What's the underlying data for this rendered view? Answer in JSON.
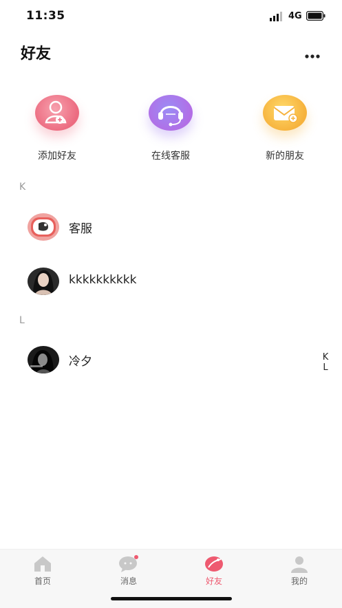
{
  "status_bar": {
    "time": "11:35",
    "network": "4G"
  },
  "header": {
    "title": "好友"
  },
  "actions": [
    {
      "label": "添加好友",
      "icon": "add-friend-icon",
      "color": "#ec6b80"
    },
    {
      "label": "在线客服",
      "icon": "headset-icon",
      "color": "#b26ee6"
    },
    {
      "label": "新的朋友",
      "icon": "envelope-icon",
      "color": "#f6b23c"
    }
  ],
  "sections": [
    {
      "letter": "K",
      "contacts": [
        {
          "name": "客服"
        },
        {
          "name": "kkkkkkkkkk"
        }
      ]
    },
    {
      "letter": "L",
      "contacts": [
        {
          "name": "冷夕"
        }
      ]
    }
  ],
  "index": [
    "K",
    "L"
  ],
  "tabs": [
    {
      "label": "首页",
      "icon": "home-icon"
    },
    {
      "label": "消息",
      "icon": "message-icon",
      "badge": true
    },
    {
      "label": "好友",
      "icon": "friends-icon",
      "active": true
    },
    {
      "label": "我的",
      "icon": "profile-icon"
    }
  ],
  "colors": {
    "accent": "#ee5a70",
    "inactive_tab": "#c8c8c8"
  }
}
